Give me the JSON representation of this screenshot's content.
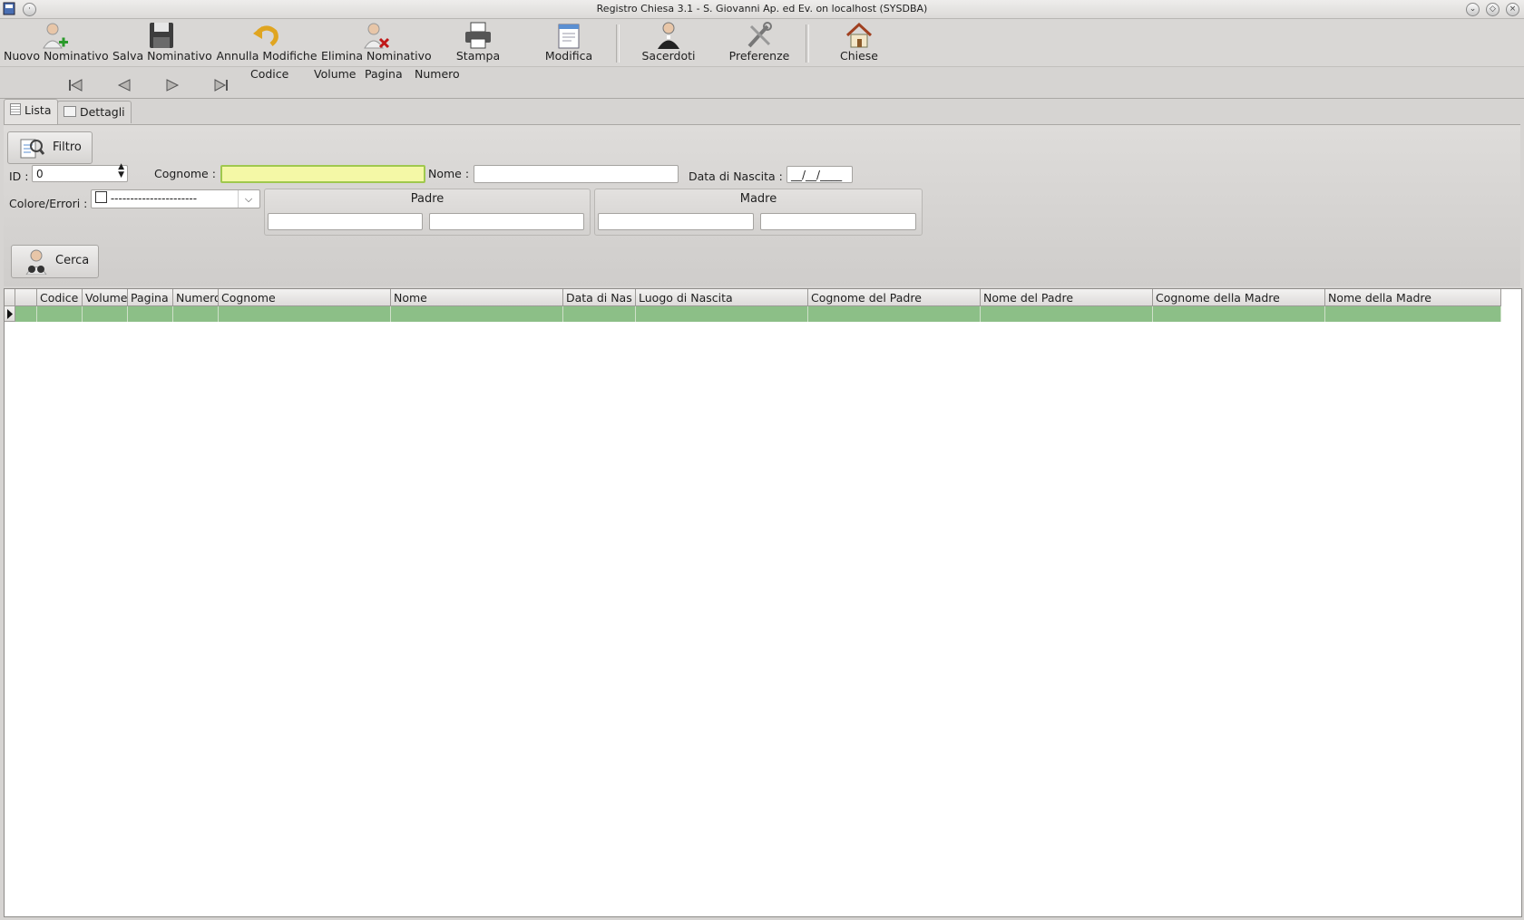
{
  "window": {
    "title": "Registro Chiesa 3.1 - S. Giovanni Ap. ed Ev. on localhost (SYSDBA)"
  },
  "toolbar": {
    "nuovo": "Nuovo Nominativo",
    "salva": "Salva Nominativo",
    "annulla": "Annulla Modifiche",
    "elimina": "Elimina Nominativo",
    "stampa": "Stampa",
    "modifica": "Modifica",
    "sacerdoti": "Sacerdoti",
    "preferenze": "Preferenze",
    "chiese": "Chiese"
  },
  "nav": {
    "codice": "Codice",
    "volume": "Volume",
    "pagina": "Pagina",
    "numero": "Numero"
  },
  "tabs": {
    "lista": "Lista",
    "dettagli": "Dettagli"
  },
  "filter": {
    "button": "Filtro",
    "id_label": "ID :",
    "id_value": "0",
    "cognome_label": "Cognome :",
    "nome_label": "Nome :",
    "data_label": "Data di Nascita :",
    "data_value": "__/__/____",
    "colore_label": "Colore/Errori :",
    "colore_value": "----------------------",
    "padre": "Padre",
    "madre": "Madre",
    "cerca": "Cerca"
  },
  "grid": {
    "columns": [
      "Codice",
      "Volume",
      "Pagina",
      "Numero",
      "Cognome",
      "Nome",
      "Data di Nas",
      "Luogo di Nascita",
      "Cognome del Padre",
      "Nome del Padre",
      "Cognome della Madre",
      "Nome della Madre"
    ],
    "selected_row_color": "#8cbf87"
  }
}
